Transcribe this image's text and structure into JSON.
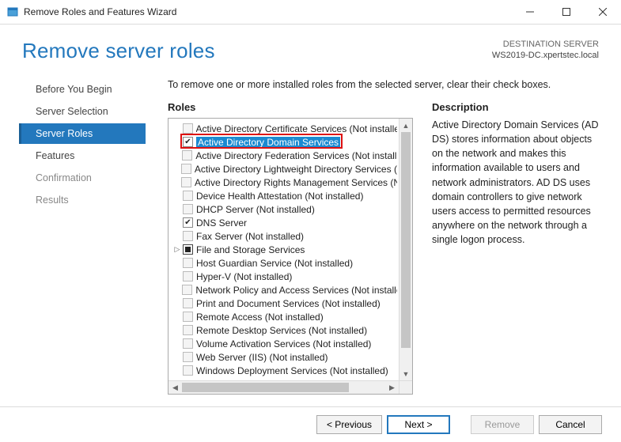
{
  "window": {
    "title": "Remove Roles and Features Wizard"
  },
  "header": {
    "heading": "Remove server roles",
    "destination_label": "DESTINATION SERVER",
    "destination_server": "WS2019-DC.xpertstec.local"
  },
  "steps": [
    {
      "label": "Before You Begin",
      "state": "done"
    },
    {
      "label": "Server Selection",
      "state": "done"
    },
    {
      "label": "Server Roles",
      "state": "active"
    },
    {
      "label": "Features",
      "state": "done"
    },
    {
      "label": "Confirmation",
      "state": "pending"
    },
    {
      "label": "Results",
      "state": "pending"
    }
  ],
  "main": {
    "intro": "To remove one or more installed roles from the selected server, clear their check boxes.",
    "roles_header": "Roles",
    "description_header": "Description",
    "description_text": "Active Directory Domain Services (AD DS) stores information about objects on the network and makes this information available to users and network administrators. AD DS uses domain controllers to give network users access to permitted resources anywhere on the network through a single logon process."
  },
  "roles": [
    {
      "label": "Active Directory Certificate Services (Not installed)",
      "check": "disabled"
    },
    {
      "label": "Active Directory Domain Services",
      "check": "checked",
      "selected": true,
      "highlighted": true
    },
    {
      "label": "Active Directory Federation Services (Not installed)",
      "check": "disabled"
    },
    {
      "label": "Active Directory Lightweight Directory Services (Not installed)",
      "check": "disabled"
    },
    {
      "label": "Active Directory Rights Management Services (Not installed)",
      "check": "disabled"
    },
    {
      "label": "Device Health Attestation (Not installed)",
      "check": "disabled"
    },
    {
      "label": "DHCP Server (Not installed)",
      "check": "disabled"
    },
    {
      "label": "DNS Server",
      "check": "checked"
    },
    {
      "label": "Fax Server (Not installed)",
      "check": "disabled"
    },
    {
      "label": "File and Storage Services",
      "check": "filled",
      "expander": true
    },
    {
      "label": "Host Guardian Service (Not installed)",
      "check": "disabled"
    },
    {
      "label": "Hyper-V (Not installed)",
      "check": "disabled"
    },
    {
      "label": "Network Policy and Access Services (Not installed)",
      "check": "disabled"
    },
    {
      "label": "Print and Document Services (Not installed)",
      "check": "disabled"
    },
    {
      "label": "Remote Access (Not installed)",
      "check": "disabled"
    },
    {
      "label": "Remote Desktop Services (Not installed)",
      "check": "disabled"
    },
    {
      "label": "Volume Activation Services (Not installed)",
      "check": "disabled"
    },
    {
      "label": "Web Server (IIS) (Not installed)",
      "check": "disabled"
    },
    {
      "label": "Windows Deployment Services (Not installed)",
      "check": "disabled"
    }
  ],
  "buttons": {
    "previous": "< Previous",
    "next": "Next >",
    "remove": "Remove",
    "cancel": "Cancel"
  }
}
